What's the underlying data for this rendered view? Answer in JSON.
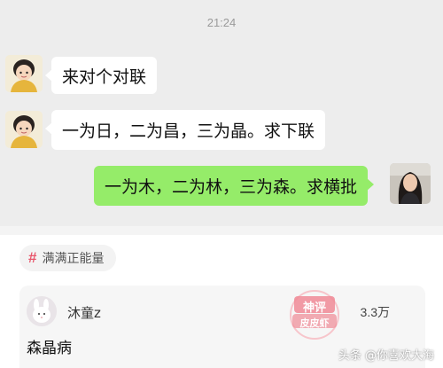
{
  "chat": {
    "timestamp": "21:24",
    "messages": [
      {
        "from": "other",
        "text": "来对个对联",
        "avatar": "cartoon-child-avatar"
      },
      {
        "from": "other",
        "text": "一为日，二为昌，三为晶。求下联",
        "avatar": "cartoon-child-avatar"
      },
      {
        "from": "self",
        "text": "一为木，二为林，三为森。求横批",
        "avatar": "woman-photo-avatar"
      }
    ]
  },
  "topic": {
    "icon": "hash-icon",
    "label": "满满正能量"
  },
  "comment": {
    "username": "沐童z",
    "likes": "3.3万",
    "text": "森晶病",
    "stamp": {
      "line1": "神评",
      "line2": "皮皮虾"
    }
  },
  "watermark": "头条 @你喜欢大海",
  "colors": {
    "chat_bg": "#ededed",
    "sent_bubble": "#95ec69",
    "received_bubble": "#ffffff",
    "topic_hash": "#e8566b",
    "stamp": "#f08a96"
  }
}
